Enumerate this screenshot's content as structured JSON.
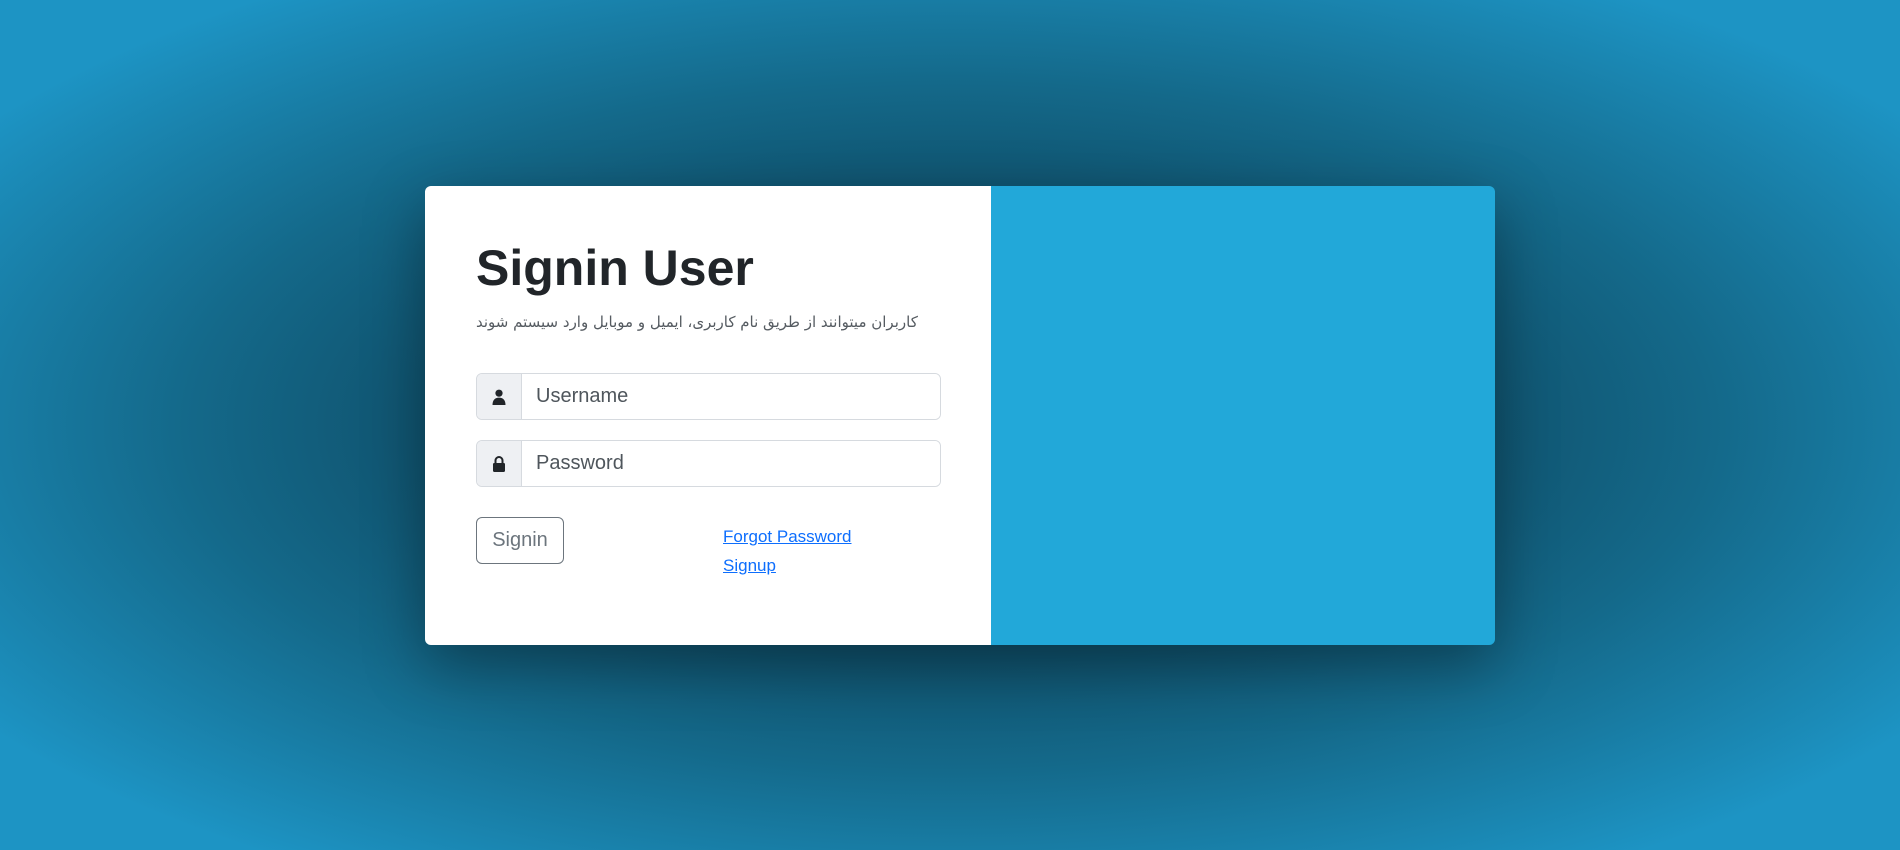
{
  "signin": {
    "title": "Signin User",
    "subtitle": "کاربران میتوانند از طریق نام کاربری، ایمیل و موبایل وارد سیستم شوند",
    "username": {
      "placeholder": "Username",
      "value": ""
    },
    "password": {
      "placeholder": "Password",
      "value": ""
    },
    "signin_label": "Signin",
    "forgot_password_label": "Forgot Password",
    "signup_label": "Signup"
  },
  "icons": {
    "username": "user-icon",
    "password": "lock-icon"
  },
  "colors": {
    "accent_panel": "#22a8d9",
    "link": "#0d6efd",
    "button_border": "#6c757d",
    "background_outer": "#1d94c4",
    "background_inner": "#0b3a4f"
  }
}
